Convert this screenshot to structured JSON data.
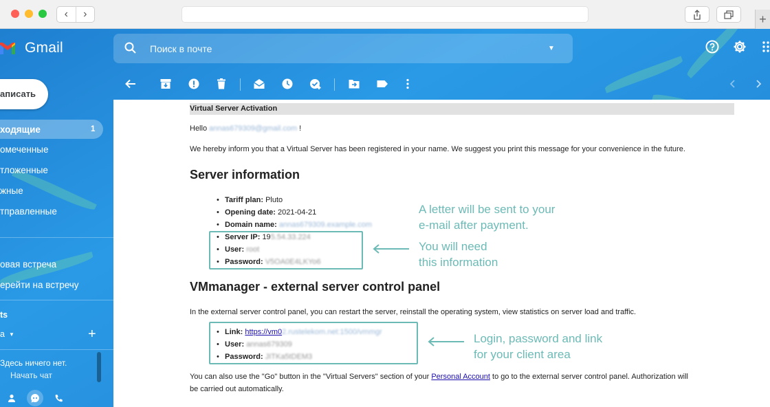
{
  "app": {
    "name": "Gmail"
  },
  "search": {
    "placeholder": "Поиск в почте"
  },
  "sidebar": {
    "compose_label": "аписать",
    "items": [
      {
        "label": "ходящие",
        "count": "1"
      },
      {
        "label": "омеченные"
      },
      {
        "label": "тложенные"
      },
      {
        "label": "жные"
      },
      {
        "label": "тправленные"
      }
    ],
    "meet": [
      {
        "label": "овая встреча"
      },
      {
        "label": "ерейти на встречу"
      }
    ],
    "chat_header": "ts",
    "chat_user": "a",
    "chat_empty": "Здесь ничего нет.",
    "chat_start": "Начать чат"
  },
  "email": {
    "subject": "Virtual Server Activation",
    "greeting": "Hello",
    "greeting_email": "annas679309@gmail.com",
    "greeting_end": "!",
    "intro": "We hereby inform you that a Virtual Server has been registered in your name. We suggest you print this message for your convenience in the future.",
    "section1_title": "Server information",
    "server_info": [
      {
        "label": "Tariff plan:",
        "value": "Pluto"
      },
      {
        "label": "Opening date:",
        "value": "2021-04-21"
      },
      {
        "label": "Domain name:",
        "value": "annas679309.example.com"
      },
      {
        "label": "Server IP:",
        "value": "19",
        "hidden": "5.54.33.224"
      },
      {
        "label": "User:",
        "value": "root"
      },
      {
        "label": "Password:",
        "value": "V5OA0E4LKYo6"
      }
    ],
    "section2_title": "VMmanager - external server control panel",
    "panel_intro": "In the external server control panel, you can restart the server, reinstall the operating system, view statistics on server load and traffic.",
    "panel_info": [
      {
        "label": "Link:",
        "value": "https://vm0",
        "hidden": "2.rustelekom.net:1500/vmmgr"
      },
      {
        "label": "User:",
        "value": "annas679309"
      },
      {
        "label": "Password:",
        "value": "JITKa5tDEM3"
      }
    ],
    "footer_part1": "You can also use the \"Go\" button in the \"Virtual Servers\" section of your",
    "footer_link": "Personal Account",
    "footer_part2": "to go to the external server control panel. Authorization will",
    "footer_line2": "be carried out automatically."
  },
  "annotations": {
    "note1_line1": "A letter will be sent to your",
    "note1_line2": "e-mail after payment.",
    "note2_line1": "You will need",
    "note2_line2": "this information",
    "note3_line1": "Login, password and link",
    "note3_line2": "for your client area",
    "accent_color": "#6cbab6"
  }
}
